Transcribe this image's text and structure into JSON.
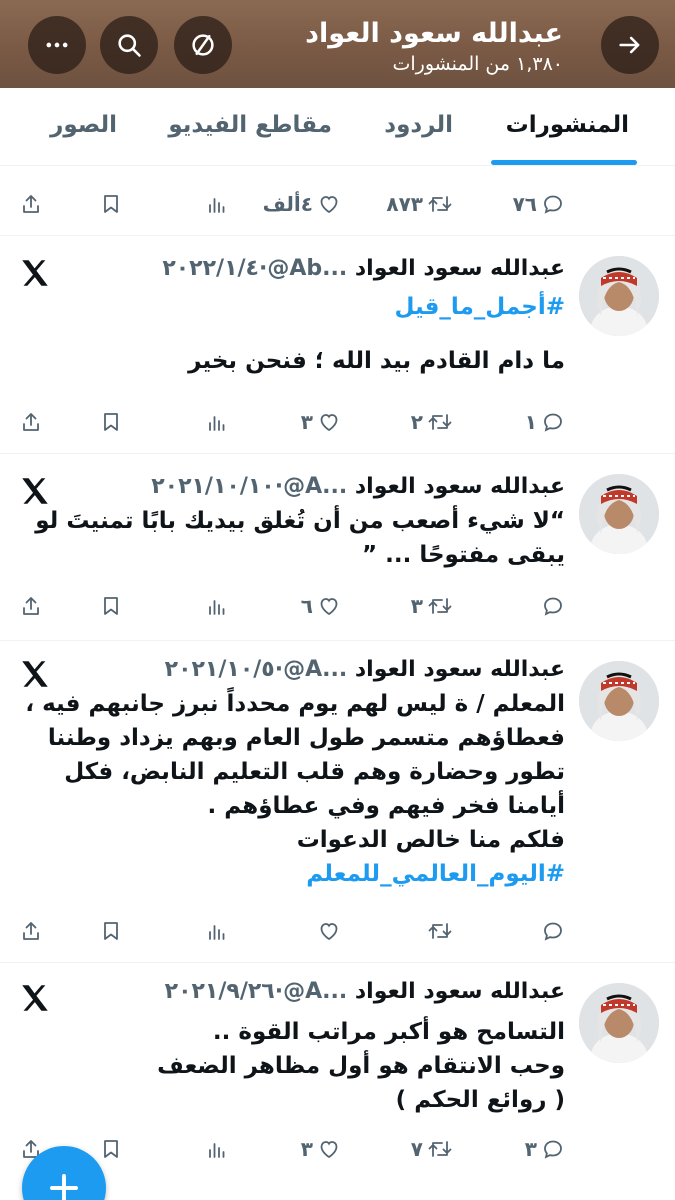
{
  "header": {
    "title": "عبدالله سعود العواد",
    "subtitle": "١,٣٨٠ من المنشورات",
    "icons": [
      "back-arrow-icon",
      "unfollow-icon",
      "search-icon",
      "more-icon"
    ]
  },
  "tabs": [
    {
      "label": "المنشورات",
      "active": true
    },
    {
      "label": "الردود",
      "active": false
    },
    {
      "label": "مقاطع الفيديو",
      "active": false
    },
    {
      "label": "الصور",
      "active": false
    }
  ],
  "top_actions": {
    "replies": "٧٦",
    "reposts": "٨٧٣",
    "likes": "٤ألف",
    "views": ""
  },
  "tweets": [
    {
      "author": "عبدالله سعود العواد",
      "handle": "...Ab@",
      "date": "٢٠٢٢/١/٤",
      "hashtag": "#أجمل_ما_قيل",
      "text": "ما دام القادم بيد الله ؛ فنحن بخير",
      "replies": "١",
      "reposts": "٢",
      "likes": "٣"
    },
    {
      "author": "عبدالله سعود العواد",
      "handle": "...A@",
      "date": "٢٠٢١/١٠/١٠",
      "text": "“لا شيء أصعب من أن تُغلق بيديك بابًا تمنيتَ لو يبقى مفتوحًا ... ”",
      "replies": "",
      "reposts": "٣",
      "likes": "٦"
    },
    {
      "author": "عبدالله سعود العواد",
      "handle": "...A@",
      "date": "٢٠٢١/١٠/٥",
      "text": "المعلم / ة ليس لهم يوم محدداً نبرز جانبهم فيه ، فعطاؤهم متسمر طول العام وبهم يزداد وطننا تطور وحضارة وهم قلب التعليم النابض، فكل أيامنا فخر فيهم وفي عطاؤهم .",
      "text2": "فلكم منا خالص الدعوات",
      "hashtag": "#اليوم_العالمي_للمعلم",
      "replies": "",
      "reposts": "",
      "likes": ""
    },
    {
      "author": "عبدالله سعود العواد",
      "handle": "...A@",
      "date": "٢٠٢١/٩/٢٦",
      "text": "التسامح هو أكبر مراتب القوة ..",
      "text2": "وحب الانتقام هو أول مظاهر الضعف",
      "text3": "( روائع الحكم )",
      "replies": "٣",
      "reposts": "٧",
      "likes": "٣"
    }
  ],
  "colors": {
    "accent": "#1d9bf0",
    "text": "#0f1419",
    "muted": "#536471",
    "header": "#7a5a45"
  }
}
